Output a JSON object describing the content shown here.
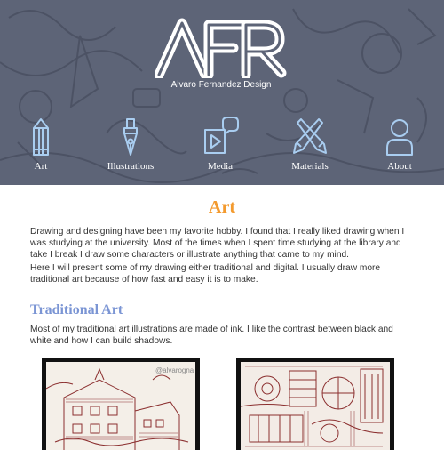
{
  "header": {
    "logo_text": "AFR",
    "tagline": "Alvaro Fernandez Design"
  },
  "nav": {
    "items": [
      {
        "label": "Art",
        "icon": "pencil-icon"
      },
      {
        "label": "Illustrations",
        "icon": "pen-nib-icon"
      },
      {
        "label": "Media",
        "icon": "media-play-icon"
      },
      {
        "label": "Materials",
        "icon": "crossed-pencils-icon"
      },
      {
        "label": "About",
        "icon": "user-icon"
      }
    ]
  },
  "main": {
    "title": "Art",
    "intro_1": "Drawing and designing have been my favorite hobby. I found that I really liked drawing when I was studying at the university. Most of the times when I spent time studying at the library and take I break I draw some characters or illustrate anything that came to my mind.",
    "intro_2": "Here I will present some of my drawing either traditional and digital. I usually draw more traditional art because of how fast and easy it is to make.",
    "section_title": "Traditional Art",
    "section_text": "Most of my traditional art illustrations are made of ink. I like the contrast between black and white and how I can build shadows.",
    "gallery": [
      {
        "watermark": "@alvarogna"
      },
      {
        "watermark": ""
      }
    ]
  },
  "colors": {
    "hero_bg": "#5d6477",
    "accent_orange": "#f39a2e",
    "section_blue": "#7b95d4",
    "nav_icon_blue": "#a9cdf0",
    "ink_red": "#8b2f2f"
  }
}
